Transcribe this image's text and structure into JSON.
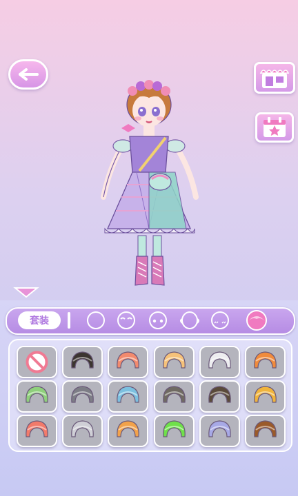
{
  "colors": {
    "accent": "#b07ae0",
    "panel": "#d7d5f6",
    "tile": "#b4b4bd"
  },
  "toolbar": {
    "back_icon": "arrow-left-icon",
    "shop_icon": "shop-icon",
    "event_icon": "calendar-star-icon",
    "collapse_icon": "triangle-down-icon"
  },
  "categories": {
    "outfit_label": "套装",
    "items": [
      {
        "name": "face-shape",
        "icon": "face-outline-icon"
      },
      {
        "name": "eyebrows",
        "icon": "eyebrows-icon"
      },
      {
        "name": "eyes",
        "icon": "eyes-icon"
      },
      {
        "name": "ears",
        "icon": "ears-icon"
      },
      {
        "name": "blush",
        "icon": "blush-icon"
      },
      {
        "name": "hair",
        "icon": "hair-icon",
        "selected": true
      }
    ]
  },
  "hair_options": [
    {
      "icon": "none-icon"
    },
    {
      "icon": "hair-icon",
      "color": "#3c3530"
    },
    {
      "icon": "hair-icon",
      "color": "#f28a6d"
    },
    {
      "icon": "hair-icon",
      "color": "#f6c27a"
    },
    {
      "icon": "hair-icon",
      "color": "#ededf0"
    },
    {
      "icon": "hair-icon",
      "color": "#f08b3c"
    },
    {
      "icon": "hair-icon",
      "color": "#8fd07c"
    },
    {
      "icon": "hair-icon",
      "color": "#7d7d86"
    },
    {
      "icon": "hair-icon",
      "color": "#7cc0e0"
    },
    {
      "icon": "hair-icon",
      "color": "#6f6a62"
    },
    {
      "icon": "hair-icon",
      "color": "#5a4a3a"
    },
    {
      "icon": "hair-icon",
      "color": "#f0b43c"
    },
    {
      "icon": "hair-icon",
      "color": "#f27a6a"
    },
    {
      "icon": "hair-icon",
      "color": "#cfcfd6"
    },
    {
      "icon": "hair-icon",
      "color": "#f2a24a"
    },
    {
      "icon": "hair-icon",
      "color": "#6fe04a"
    },
    {
      "icon": "hair-icon",
      "color": "#a7a9e6"
    },
    {
      "icon": "hair-icon",
      "color": "#9a5a2a"
    }
  ]
}
